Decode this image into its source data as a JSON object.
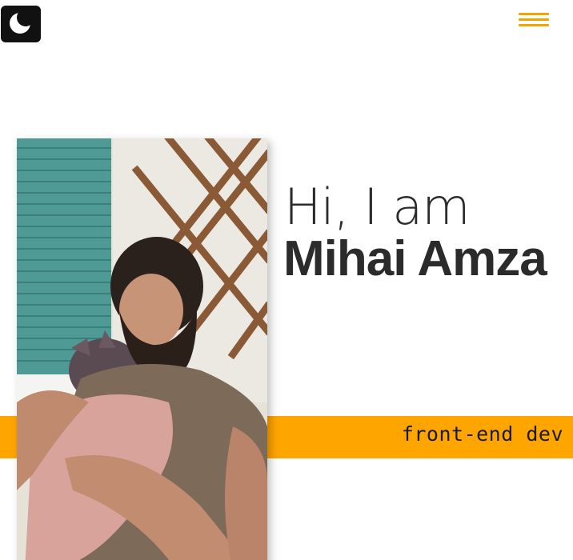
{
  "header": {
    "theme_toggle_icon": "moon-icon",
    "menu_icon": "hamburger-menu-icon",
    "accent_color": "#f0a500"
  },
  "hero": {
    "greeting": "Hi, I am",
    "name": "Mihai Amza",
    "role": "front-end dev",
    "photo_alt": "Mihai Amza holding a hairless cat",
    "accent_band_color": "#ffa500"
  }
}
